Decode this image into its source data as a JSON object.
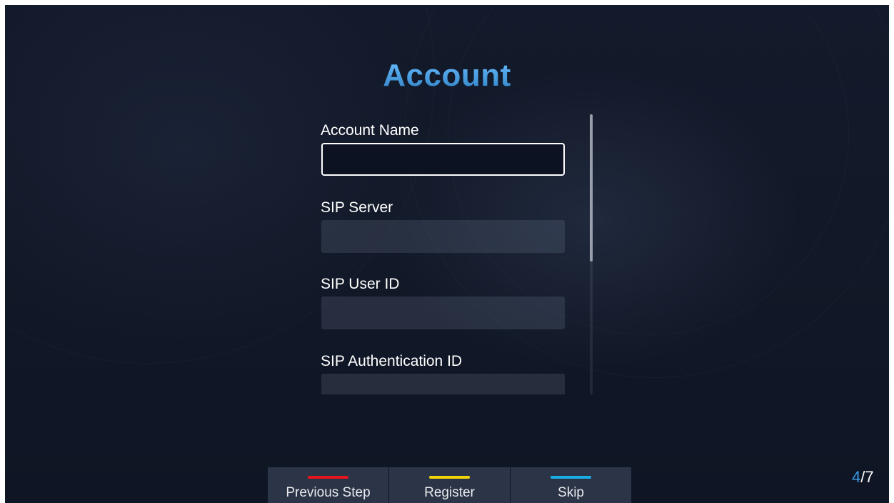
{
  "title": "Account",
  "fields": [
    {
      "label": "Account Name",
      "value": "",
      "focused": true
    },
    {
      "label": "SIP Server",
      "value": "",
      "focused": false
    },
    {
      "label": "SIP User ID",
      "value": "",
      "focused": false
    },
    {
      "label": "SIP Authentication ID",
      "value": "",
      "focused": false
    }
  ],
  "actions": [
    {
      "label": "Previous Step",
      "color": "#e8141c"
    },
    {
      "label": "Register",
      "color": "#f2d60c"
    },
    {
      "label": "Skip",
      "color": "#18aee6"
    }
  ],
  "page": {
    "current": "4",
    "separator": "/",
    "total": "7"
  },
  "colors": {
    "accent": "#3a9ae8",
    "background": "#121929"
  }
}
